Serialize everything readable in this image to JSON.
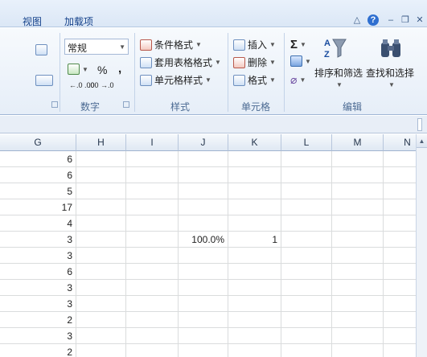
{
  "tabs": [
    {
      "label": "视图"
    },
    {
      "label": "加载项"
    }
  ],
  "window_controls": {
    "minimize_ribbon": "△",
    "help": "?",
    "minimize": "–",
    "restore": "❐",
    "close": "✕"
  },
  "ribbon": {
    "number": {
      "format_value": "常规",
      "currency_symbol": "%",
      "comma": ",",
      "increase_decimal": "←.0 .00",
      "decrease_decimal": ".00 →.0",
      "label": "数字"
    },
    "styles": {
      "conditional_format": "条件格式",
      "format_as_table": "套用表格格式",
      "cell_styles": "单元格样式",
      "label": "样式"
    },
    "cells": {
      "insert": "插入",
      "delete": "删除",
      "format": "格式",
      "label": "单元格"
    },
    "editing": {
      "sigma": "Σ",
      "sort_filter": "排序和筛选",
      "find_select": "查找和选择",
      "label": "编辑"
    }
  },
  "columns": [
    "G",
    "H",
    "I",
    "J",
    "K",
    "L",
    "M",
    "N"
  ],
  "rows": [
    {
      "G": "6",
      "J": "",
      "K": ""
    },
    {
      "G": "6",
      "J": "",
      "K": ""
    },
    {
      "G": "5",
      "J": "",
      "K": ""
    },
    {
      "G": "17",
      "J": "",
      "K": ""
    },
    {
      "G": "4",
      "J": "",
      "K": ""
    },
    {
      "G": "3",
      "J": "100.0%",
      "K": "1"
    },
    {
      "G": "3",
      "J": "",
      "K": ""
    },
    {
      "G": "6",
      "J": "",
      "K": ""
    },
    {
      "G": "3",
      "J": "",
      "K": ""
    },
    {
      "G": "3",
      "J": "",
      "K": ""
    },
    {
      "G": "2",
      "J": "",
      "K": ""
    },
    {
      "G": "3",
      "J": "",
      "K": ""
    },
    {
      "G": "2",
      "J": "",
      "K": ""
    }
  ]
}
